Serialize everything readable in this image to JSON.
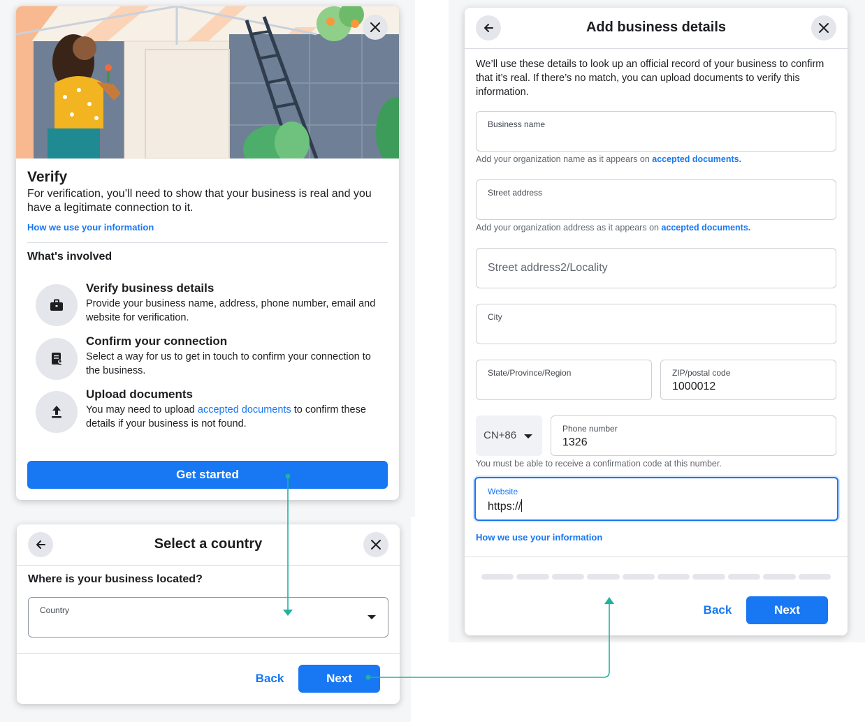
{
  "verify_card": {
    "title": "Verify",
    "description": "For verification, you’ll need to show that your business is real and you have a legitimate connection to it.",
    "info_link": "How we use your information",
    "section_title": "What's involved",
    "features": [
      {
        "icon": "briefcase-icon",
        "title": "Verify business details",
        "desc": "Provide your business name, address, phone number, email and website for verification."
      },
      {
        "icon": "document-person-icon",
        "title": "Confirm your connection",
        "desc": "Select a way for us to get in touch to confirm your connection to the business."
      },
      {
        "icon": "upload-icon",
        "title": "Upload documents",
        "desc_before": "You may need to upload ",
        "desc_link": "accepted documents",
        "desc_after": " to confirm these details if your business is not found."
      }
    ],
    "cta": "Get started"
  },
  "country_card": {
    "title": "Select a country",
    "question": "Where is your business located?",
    "country_label": "Country",
    "back": "Back",
    "next": "Next"
  },
  "details_card": {
    "title": "Add business details",
    "intro": "We’ll use these details to look up an official record of your business to confirm that it’s real. If there’s no match, you can upload documents to verify this information.",
    "business_name_label": "Business name",
    "business_name_hint": "Add your organization name as it appears on ",
    "street_label": "Street address",
    "street_hint": "Add your organization address as it appears on ",
    "hint_link": "accepted documents.",
    "street2_placeholder": "Street address2/Locality",
    "city_label": "City",
    "state_label": "State/Province/Region",
    "zip_label": "ZIP/postal code",
    "zip_value": "1000012",
    "country_code": "CN+86",
    "phone_label": "Phone number",
    "phone_value": "1326",
    "phone_hint": "You must be able to receive a confirmation code at this number.",
    "website_label": "Website",
    "website_value": "https://",
    "info_link": "How we use your information",
    "progress_total_steps": 10,
    "back": "Back",
    "next": "Next"
  },
  "colors": {
    "accent": "#1877f2",
    "connector": "#20b2a0"
  }
}
